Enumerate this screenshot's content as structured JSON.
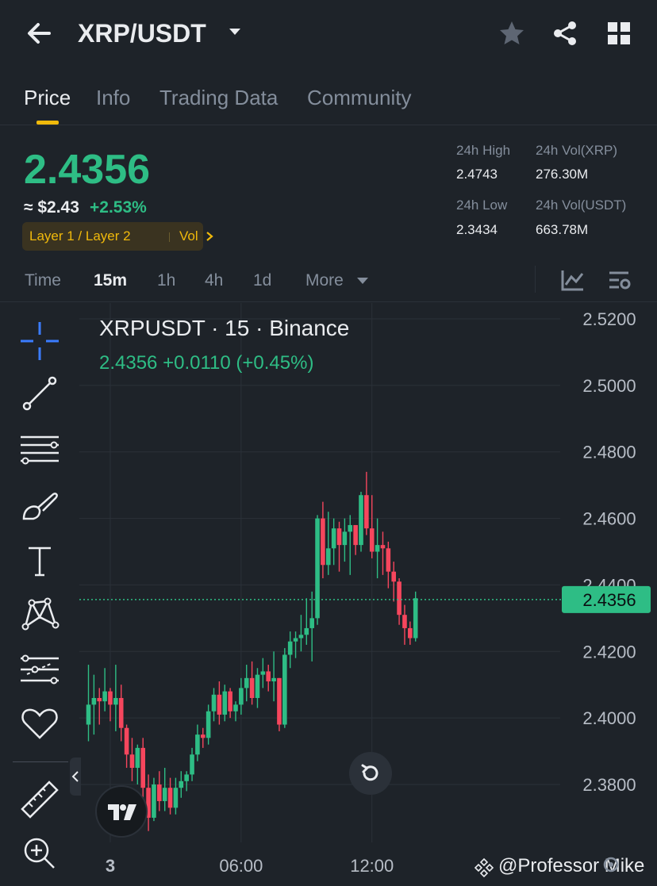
{
  "header": {
    "pair": "XRP/USDT",
    "icons": [
      "back-arrow-icon",
      "caret-down-icon",
      "star-icon",
      "share-icon",
      "grid-icon"
    ]
  },
  "tabs": [
    {
      "label": "Price",
      "active": true
    },
    {
      "label": "Info",
      "active": false
    },
    {
      "label": "Trading Data",
      "active": false
    },
    {
      "label": "Community",
      "active": false
    }
  ],
  "summary": {
    "last_price": "2.4356",
    "usd_price": "≈ $2.43",
    "change_pct": "+2.53%",
    "tag_layers": "Layer 1 / Layer 2",
    "tag_vol": "Vol",
    "high_label": "24h High",
    "high_value": "2.4743",
    "low_label": "24h Low",
    "low_value": "2.3434",
    "vol_xrp_label": "24h Vol(XRP)",
    "vol_xrp_value": "276.30M",
    "vol_usdt_label": "24h Vol(USDT)",
    "vol_usdt_value": "663.78M"
  },
  "timeframes": {
    "items": [
      "Time",
      "15m",
      "1h",
      "4h",
      "1d",
      "More"
    ],
    "active": "15m"
  },
  "chart": {
    "title": "XRPUSDT · 15 · Binance",
    "ohlc_line": "2.4356  +0.0110 (+0.45%)",
    "up_color": "#2ebd85",
    "down_color": "#f6465d"
  },
  "tools": [
    "crosshair-icon",
    "trend-line-icon",
    "fib-lines-icon",
    "brush-icon",
    "text-icon",
    "pattern-icon",
    "forecast-icon",
    "heart-icon",
    "ruler-icon",
    "zoom-in-icon"
  ],
  "watermark": "@Professor Mike",
  "chart_data": {
    "type": "candlestick",
    "symbol": "XRPUSDT",
    "interval": "15",
    "exchange": "Binance",
    "ylim": [
      2.365,
      2.527
    ],
    "yticks": [
      "2.5200",
      "2.5000",
      "2.4800",
      "2.4600",
      "2.4400",
      "2.4200",
      "2.4000",
      "2.3800"
    ],
    "xticks": [
      {
        "label": "3",
        "index": 4
      },
      {
        "label": "06:00",
        "index": 28
      },
      {
        "label": "12:00",
        "index": 52
      }
    ],
    "current_price_label": "2.4356",
    "current_price": 2.4356,
    "candles": [
      {
        "o": 2.398,
        "h": 2.416,
        "l": 2.393,
        "c": 2.404
      },
      {
        "o": 2.404,
        "h": 2.413,
        "l": 2.395,
        "c": 2.406
      },
      {
        "o": 2.406,
        "h": 2.409,
        "l": 2.398,
        "c": 2.405
      },
      {
        "o": 2.405,
        "h": 2.415,
        "l": 2.402,
        "c": 2.408
      },
      {
        "o": 2.408,
        "h": 2.409,
        "l": 2.399,
        "c": 2.404
      },
      {
        "o": 2.404,
        "h": 2.416,
        "l": 2.396,
        "c": 2.406
      },
      {
        "o": 2.406,
        "h": 2.41,
        "l": 2.393,
        "c": 2.397
      },
      {
        "o": 2.397,
        "h": 2.398,
        "l": 2.385,
        "c": 2.389
      },
      {
        "o": 2.389,
        "h": 2.394,
        "l": 2.381,
        "c": 2.385
      },
      {
        "o": 2.385,
        "h": 2.392,
        "l": 2.38,
        "c": 2.391
      },
      {
        "o": 2.391,
        "h": 2.394,
        "l": 2.376,
        "c": 2.379
      },
      {
        "o": 2.379,
        "h": 2.383,
        "l": 2.366,
        "c": 2.37
      },
      {
        "o": 2.37,
        "h": 2.382,
        "l": 2.369,
        "c": 2.38
      },
      {
        "o": 2.38,
        "h": 2.384,
        "l": 2.372,
        "c": 2.375
      },
      {
        "o": 2.375,
        "h": 2.385,
        "l": 2.372,
        "c": 2.379
      },
      {
        "o": 2.379,
        "h": 2.382,
        "l": 2.371,
        "c": 2.373
      },
      {
        "o": 2.373,
        "h": 2.382,
        "l": 2.371,
        "c": 2.379
      },
      {
        "o": 2.379,
        "h": 2.384,
        "l": 2.376,
        "c": 2.381
      },
      {
        "o": 2.381,
        "h": 2.384,
        "l": 2.378,
        "c": 2.383
      },
      {
        "o": 2.383,
        "h": 2.391,
        "l": 2.381,
        "c": 2.389
      },
      {
        "o": 2.389,
        "h": 2.398,
        "l": 2.387,
        "c": 2.395
      },
      {
        "o": 2.395,
        "h": 2.397,
        "l": 2.391,
        "c": 2.394
      },
      {
        "o": 2.394,
        "h": 2.404,
        "l": 2.392,
        "c": 2.402
      },
      {
        "o": 2.402,
        "h": 2.409,
        "l": 2.399,
        "c": 2.407
      },
      {
        "o": 2.407,
        "h": 2.411,
        "l": 2.398,
        "c": 2.401
      },
      {
        "o": 2.401,
        "h": 2.41,
        "l": 2.399,
        "c": 2.408
      },
      {
        "o": 2.408,
        "h": 2.409,
        "l": 2.4,
        "c": 2.402
      },
      {
        "o": 2.402,
        "h": 2.405,
        "l": 2.399,
        "c": 2.404
      },
      {
        "o": 2.404,
        "h": 2.412,
        "l": 2.401,
        "c": 2.409
      },
      {
        "o": 2.409,
        "h": 2.416,
        "l": 2.405,
        "c": 2.412
      },
      {
        "o": 2.412,
        "h": 2.417,
        "l": 2.404,
        "c": 2.406
      },
      {
        "o": 2.406,
        "h": 2.415,
        "l": 2.403,
        "c": 2.413
      },
      {
        "o": 2.413,
        "h": 2.418,
        "l": 2.409,
        "c": 2.414
      },
      {
        "o": 2.414,
        "h": 2.416,
        "l": 2.408,
        "c": 2.411
      },
      {
        "o": 2.411,
        "h": 2.42,
        "l": 2.405,
        "c": 2.412
      },
      {
        "o": 2.412,
        "h": 2.412,
        "l": 2.396,
        "c": 2.398
      },
      {
        "o": 2.398,
        "h": 2.421,
        "l": 2.397,
        "c": 2.419
      },
      {
        "o": 2.419,
        "h": 2.426,
        "l": 2.415,
        "c": 2.423
      },
      {
        "o": 2.423,
        "h": 2.426,
        "l": 2.418,
        "c": 2.424
      },
      {
        "o": 2.424,
        "h": 2.431,
        "l": 2.42,
        "c": 2.425
      },
      {
        "o": 2.425,
        "h": 2.436,
        "l": 2.422,
        "c": 2.427
      },
      {
        "o": 2.427,
        "h": 2.438,
        "l": 2.417,
        "c": 2.43
      },
      {
        "o": 2.43,
        "h": 2.461,
        "l": 2.428,
        "c": 2.46
      },
      {
        "o": 2.46,
        "h": 2.465,
        "l": 2.442,
        "c": 2.446
      },
      {
        "o": 2.446,
        "h": 2.462,
        "l": 2.443,
        "c": 2.451
      },
      {
        "o": 2.451,
        "h": 2.46,
        "l": 2.446,
        "c": 2.457
      },
      {
        "o": 2.457,
        "h": 2.459,
        "l": 2.444,
        "c": 2.452
      },
      {
        "o": 2.452,
        "h": 2.46,
        "l": 2.447,
        "c": 2.456
      },
      {
        "o": 2.456,
        "h": 2.461,
        "l": 2.443,
        "c": 2.458
      },
      {
        "o": 2.458,
        "h": 2.458,
        "l": 2.449,
        "c": 2.452
      },
      {
        "o": 2.452,
        "h": 2.468,
        "l": 2.45,
        "c": 2.467
      },
      {
        "o": 2.467,
        "h": 2.474,
        "l": 2.455,
        "c": 2.457
      },
      {
        "o": 2.457,
        "h": 2.467,
        "l": 2.448,
        "c": 2.45
      },
      {
        "o": 2.45,
        "h": 2.46,
        "l": 2.442,
        "c": 2.452
      },
      {
        "o": 2.452,
        "h": 2.456,
        "l": 2.443,
        "c": 2.451
      },
      {
        "o": 2.451,
        "h": 2.453,
        "l": 2.439,
        "c": 2.444
      },
      {
        "o": 2.444,
        "h": 2.447,
        "l": 2.435,
        "c": 2.441
      },
      {
        "o": 2.441,
        "h": 2.442,
        "l": 2.428,
        "c": 2.431
      },
      {
        "o": 2.431,
        "h": 2.434,
        "l": 2.422,
        "c": 2.427
      },
      {
        "o": 2.427,
        "h": 2.429,
        "l": 2.422,
        "c": 2.424
      },
      {
        "o": 2.424,
        "h": 2.438,
        "l": 2.423,
        "c": 2.436
      }
    ]
  }
}
